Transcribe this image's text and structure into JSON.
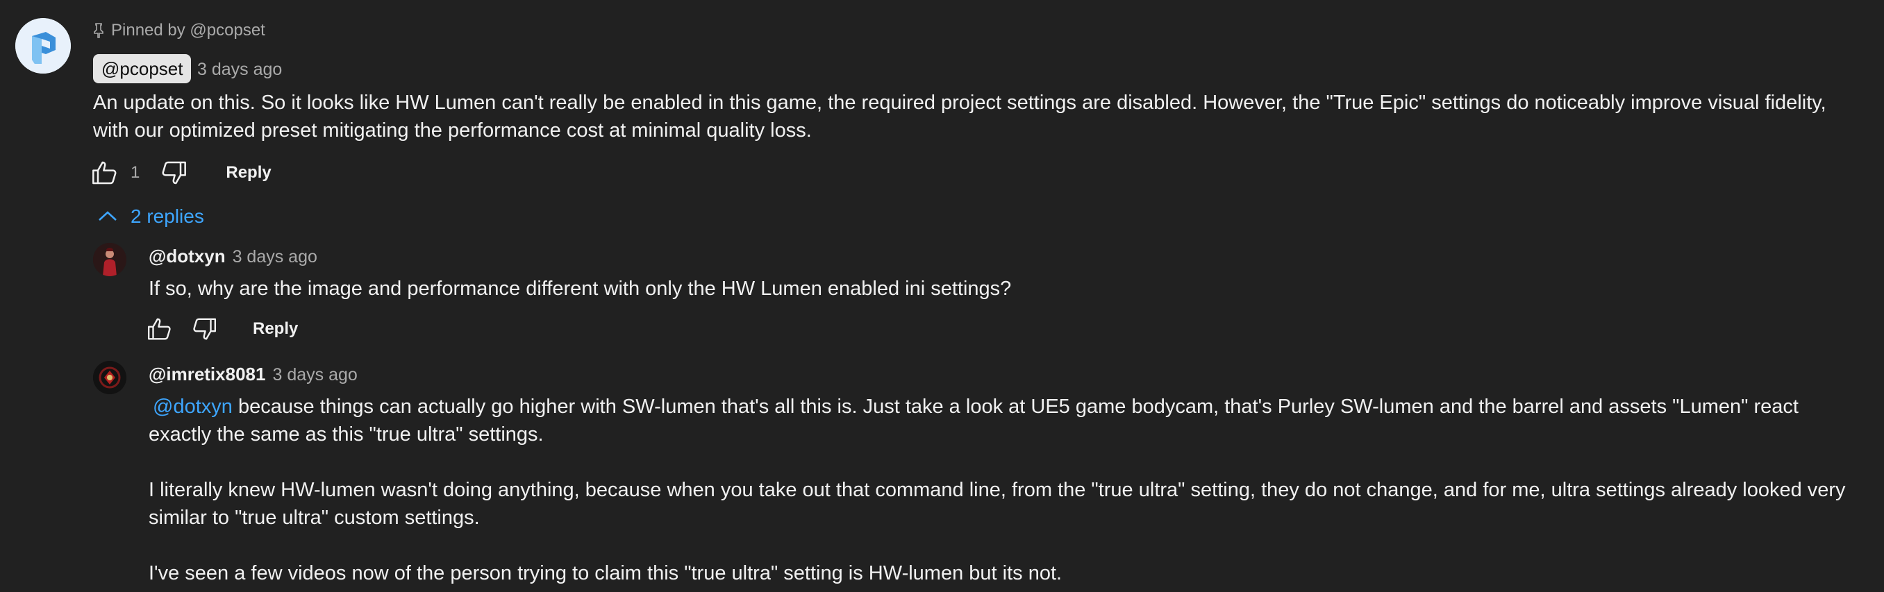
{
  "pinned": {
    "label": "Pinned by @pcopset"
  },
  "comment": {
    "author": "@pcopset",
    "time": "3 days ago",
    "text": "An update on this. So it looks like HW Lumen can't really be enabled in this game, the required project settings are disabled. However, the \"True Epic\" settings do noticeably improve visual fidelity, with our optimized preset mitigating the performance cost at minimal quality loss.",
    "like_count": "1",
    "reply_label": "Reply",
    "replies_toggle": "2 replies"
  },
  "replies": [
    {
      "author": "@dotxyn",
      "time": "3 days ago",
      "text": "If so, why are the image and performance different with only the HW Lumen enabled ini settings?",
      "reply_label": "Reply"
    },
    {
      "author": "@imretix8081",
      "time": "3 days ago",
      "mention": "@dotxyn",
      "text_1": " because things can actually go higher with SW-lumen that's all this is. Just take a look at UE5 game bodycam, that's Purley SW-lumen and the barrel and assets \"Lumen\" react exactly the same as this \"true ultra\" settings.",
      "text_2": "I literally knew HW-lumen wasn't doing anything, because when you take out that command line, from the \"true ultra\" setting, they do not change, and for me, ultra settings already looked very similar to \"true ultra\" custom settings.",
      "text_3": "I've seen a few videos now of the person trying to claim this \"true ultra\" setting is HW-lumen but its not."
    }
  ],
  "colors": {
    "background": "#212121",
    "text": "#f1f1f1",
    "muted": "#aaaaaa",
    "link": "#3ea6ff",
    "author_chip": "#e5e5e5"
  },
  "icons": [
    "pin-icon",
    "thumbs-up-icon",
    "thumbs-down-icon",
    "chevron-up-icon"
  ]
}
